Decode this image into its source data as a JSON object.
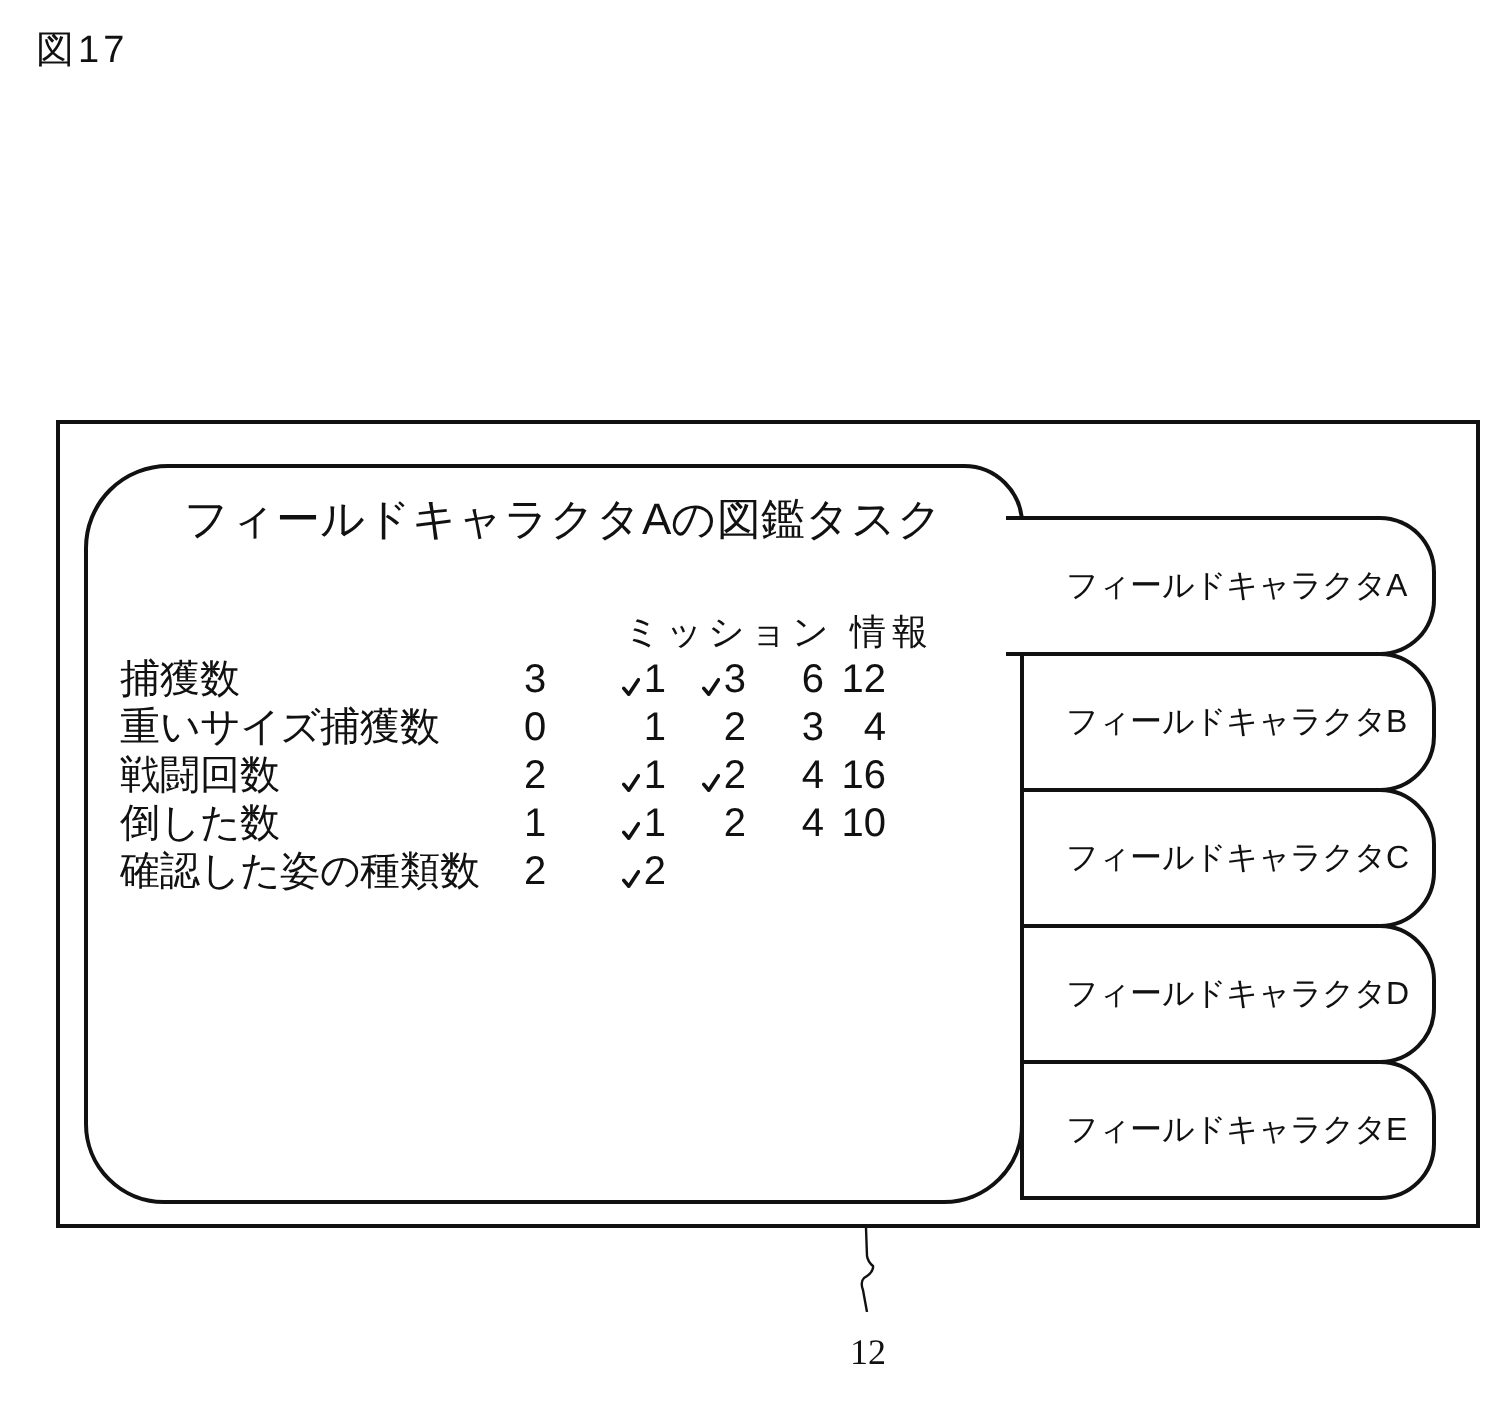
{
  "figure_label": "図17",
  "panel": {
    "title": "フィールドキャラクタAの図鑑タスク",
    "mission_header": "ミッション 情報",
    "rows": [
      {
        "label": "捕獲数",
        "count": "3",
        "missions": [
          {
            "value": "1",
            "checked": true
          },
          {
            "value": "3",
            "checked": true
          },
          {
            "value": "6",
            "checked": false
          },
          {
            "value": "12",
            "checked": false
          }
        ]
      },
      {
        "label": "重いサイズ捕獲数",
        "count": "0",
        "missions": [
          {
            "value": "1",
            "checked": false
          },
          {
            "value": "2",
            "checked": false
          },
          {
            "value": "3",
            "checked": false
          },
          {
            "value": "4",
            "checked": false
          }
        ]
      },
      {
        "label": "戦闘回数",
        "count": "2",
        "missions": [
          {
            "value": "1",
            "checked": true
          },
          {
            "value": "2",
            "checked": true
          },
          {
            "value": "4",
            "checked": false
          },
          {
            "value": "16",
            "checked": false
          }
        ]
      },
      {
        "label": "倒した数",
        "count": "1",
        "missions": [
          {
            "value": "1",
            "checked": true
          },
          {
            "value": "2",
            "checked": false
          },
          {
            "value": "4",
            "checked": false
          },
          {
            "value": "10",
            "checked": false
          }
        ]
      },
      {
        "label": "確認した姿の種類数",
        "count": "2",
        "missions": [
          {
            "value": "2",
            "checked": true
          }
        ]
      }
    ]
  },
  "tabs": [
    {
      "label": "フィールドキャラクタA",
      "selected": true
    },
    {
      "label": "フィールドキャラクタB",
      "selected": false
    },
    {
      "label": "フィールドキャラクタC",
      "selected": false
    },
    {
      "label": "フィールドキャラクタD",
      "selected": false
    },
    {
      "label": "フィールドキャラクタE",
      "selected": false
    }
  ],
  "reference_numeral": "12"
}
